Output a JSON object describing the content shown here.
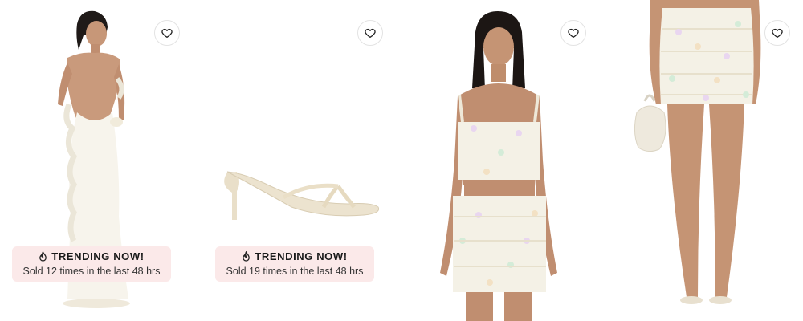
{
  "products": [
    {
      "name": "white-ruffle-backless-gown",
      "favorite_icon": "heart-outline-icon",
      "trending": {
        "icon": "flame-icon",
        "title": "TRENDING NOW!",
        "subtitle": "Sold 12 times in the last 48 hrs"
      }
    },
    {
      "name": "ivory-strappy-kitten-heel-sandal",
      "favorite_icon": "heart-outline-icon",
      "trending": {
        "icon": "flame-icon",
        "title": "TRENDING NOW!",
        "subtitle": "Sold 19 times in the last 48 hrs"
      }
    },
    {
      "name": "sequin-fringe-crop-top-and-skirt-set",
      "favorite_icon": "heart-outline-icon"
    },
    {
      "name": "sequin-fringe-mini-skirt",
      "favorite_icon": "heart-outline-icon"
    }
  ],
  "colors": {
    "badge_bg": "#fbe9e9",
    "dress": "#f7f4ec",
    "fringe": "#f4f1e6"
  }
}
